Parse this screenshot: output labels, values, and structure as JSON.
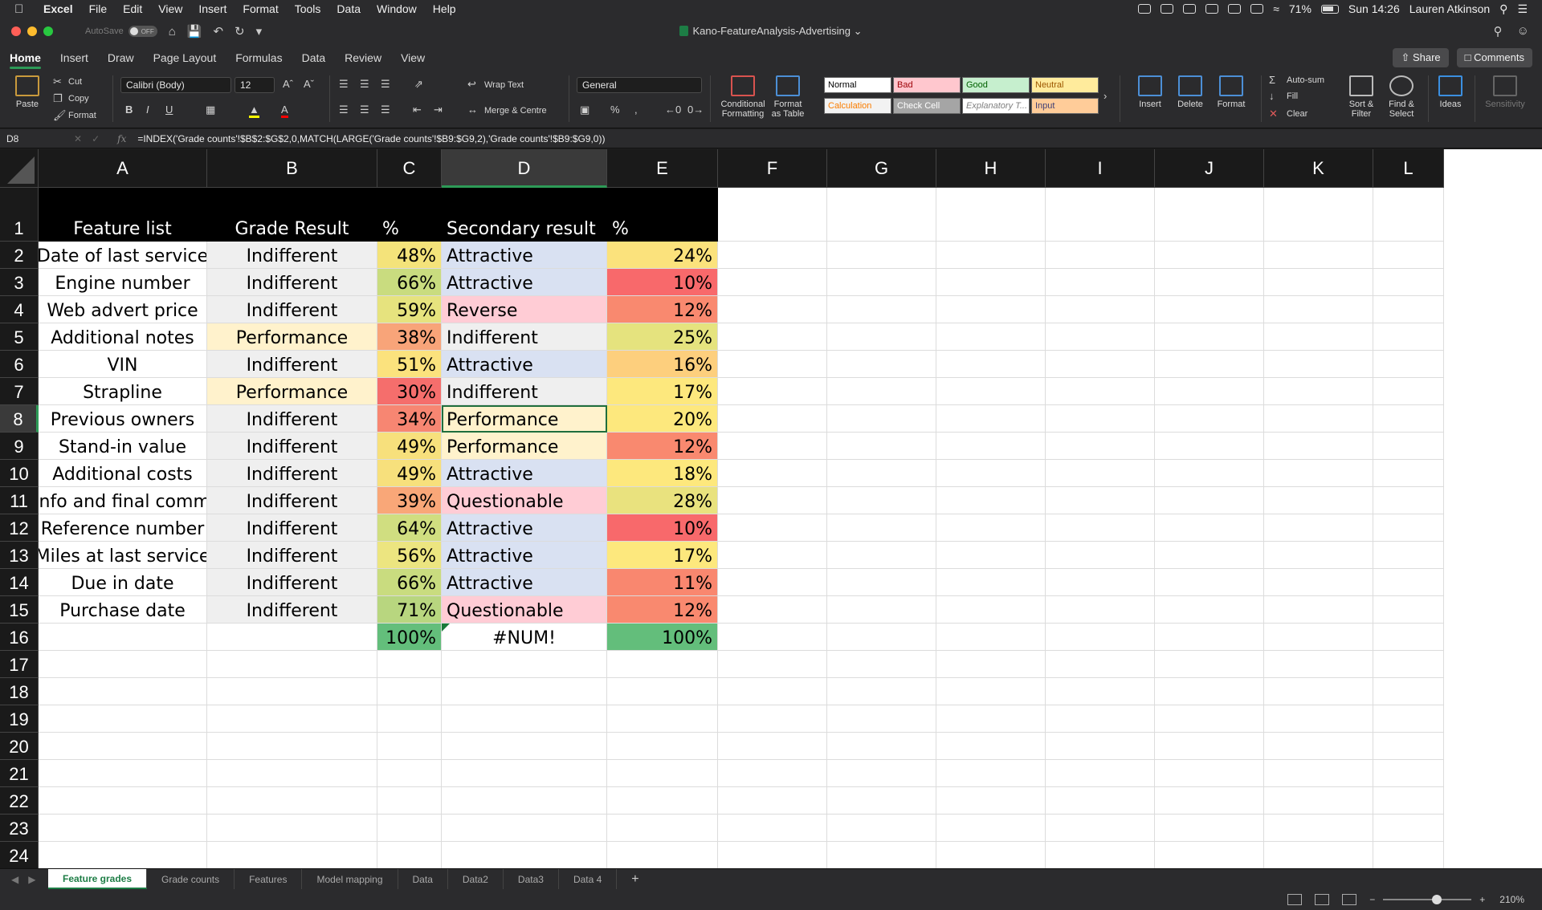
{
  "menubar": {
    "app": "Excel",
    "items": [
      "File",
      "Edit",
      "View",
      "Insert",
      "Format",
      "Tools",
      "Data",
      "Window",
      "Help"
    ],
    "battery": "71%",
    "clock": "Sun 14:26",
    "user": "Lauren Atkinson"
  },
  "titlebar": {
    "autosave_label": "AutoSave",
    "autosave_state": "OFF",
    "doc_title": "Kano-FeatureAnalysis-Advertising"
  },
  "ribbon_tabs": {
    "items": [
      "Home",
      "Insert",
      "Draw",
      "Page Layout",
      "Formulas",
      "Data",
      "Review",
      "View"
    ],
    "active": "Home",
    "share": "Share",
    "comments": "Comments"
  },
  "ribbon": {
    "paste": "Paste",
    "cut": "Cut",
    "copy": "Copy",
    "format_painter": "Format",
    "font_name": "Calibri (Body)",
    "font_size": "12",
    "wrap_text": "Wrap Text",
    "merge_centre": "Merge & Centre",
    "number_format": "General",
    "conditional_formatting": "Conditional Formatting",
    "format_as_table": "Format as Table",
    "styles": [
      {
        "name": "Normal",
        "bg": "#ffffff",
        "fg": "#000000"
      },
      {
        "name": "Bad",
        "bg": "#ffc7ce",
        "fg": "#9c0006"
      },
      {
        "name": "Good",
        "bg": "#c6efce",
        "fg": "#006100"
      },
      {
        "name": "Neutral",
        "bg": "#ffeb9c",
        "fg": "#9c5700"
      },
      {
        "name": "Calculation",
        "bg": "#f2f2f2",
        "fg": "#fa7d00"
      },
      {
        "name": "Check Cell",
        "bg": "#a5a5a5",
        "fg": "#ffffff"
      },
      {
        "name": "Explanatory T...",
        "bg": "#ffffff",
        "fg": "#7f7f7f"
      },
      {
        "name": "Input",
        "bg": "#ffcc99",
        "fg": "#3f3f76"
      }
    ],
    "insert": "Insert",
    "delete": "Delete",
    "format": "Format",
    "autosum": "Auto-sum",
    "fill": "Fill",
    "clear": "Clear",
    "sort_filter": "Sort & Filter",
    "find_select": "Find & Select",
    "ideas": "Ideas",
    "sensitivity": "Sensitivity"
  },
  "formula_bar": {
    "name_box": "D8",
    "formula": "=INDEX('Grade counts'!$B$2:$G$2,0,MATCH(LARGE('Grade counts'!$B9:$G9,2),'Grade counts'!$B9:$G9,0))"
  },
  "grid": {
    "columns": [
      "A",
      "B",
      "C",
      "D",
      "E",
      "F",
      "G",
      "H",
      "I",
      "J",
      "K",
      "L"
    ],
    "header_row": [
      "Feature list",
      "Grade Result",
      "%",
      "Secondary result",
      "%"
    ],
    "rows": [
      {
        "feature": "Date of last service",
        "grade": "Indifferent",
        "pct": "48%",
        "secondary": "Attractive",
        "pct2": "24%"
      },
      {
        "feature": "Engine number",
        "grade": "Indifferent",
        "pct": "66%",
        "secondary": "Attractive",
        "pct2": "10%"
      },
      {
        "feature": "Web advert price",
        "grade": "Indifferent",
        "pct": "59%",
        "secondary": "Reverse",
        "pct2": "12%"
      },
      {
        "feature": "Additional notes",
        "grade": "Performance",
        "pct": "38%",
        "secondary": "Indifferent",
        "pct2": "25%"
      },
      {
        "feature": "VIN",
        "grade": "Indifferent",
        "pct": "51%",
        "secondary": "Attractive",
        "pct2": "16%"
      },
      {
        "feature": "Strapline",
        "grade": "Performance",
        "pct": "30%",
        "secondary": "Indifferent",
        "pct2": "17%"
      },
      {
        "feature": "Previous owners",
        "grade": "Indifferent",
        "pct": "34%",
        "secondary": "Performance",
        "pct2": "20%"
      },
      {
        "feature": "Stand-in value",
        "grade": "Indifferent",
        "pct": "49%",
        "secondary": "Performance",
        "pct2": "12%"
      },
      {
        "feature": "Additional costs",
        "grade": "Indifferent",
        "pct": "49%",
        "secondary": "Attractive",
        "pct2": "18%"
      },
      {
        "feature": "Key info and final comments",
        "grade": "Indifferent",
        "pct": "39%",
        "secondary": "Questionable",
        "pct2": "28%"
      },
      {
        "feature": "Reference number",
        "grade": "Indifferent",
        "pct": "64%",
        "secondary": "Attractive",
        "pct2": "10%"
      },
      {
        "feature": "Miles at last service",
        "grade": "Indifferent",
        "pct": "56%",
        "secondary": "Attractive",
        "pct2": "17%"
      },
      {
        "feature": "Due in date",
        "grade": "Indifferent",
        "pct": "66%",
        "secondary": "Attractive",
        "pct2": "11%"
      },
      {
        "feature": "Purchase date",
        "grade": "Indifferent",
        "pct": "71%",
        "secondary": "Questionable",
        "pct2": "12%"
      }
    ],
    "totals": {
      "pct": "100%",
      "secondary": "#NUM!",
      "pct2": "100%"
    },
    "active_cell": "D8",
    "colors": {
      "grade": {
        "Indifferent": "#efefef",
        "Performance": "#fff2cc"
      },
      "secondary": {
        "Attractive": "#d9e1f2",
        "Reverse": "#ffccd5",
        "Indifferent": "#efefef",
        "Performance": "#fff2cc",
        "Questionable": "#ffccd5"
      },
      "pct_c": [
        "#f4e37a",
        "#c9dc7f",
        "#e6e37e",
        "#f8a479",
        "#fbe27d",
        "#f56e6c",
        "#f78672",
        "#f7e07c",
        "#f7e07c",
        "#f9a778",
        "#d0de80",
        "#ece580",
        "#c9dc7f",
        "#b8d67f"
      ],
      "pct_e": [
        "#fbe27c",
        "#f8696b",
        "#f9896f",
        "#e5e37e",
        "#fdcf7d",
        "#fde87d",
        "#fde87d",
        "#f9896f",
        "#fde87d",
        "#e9e27e",
        "#f8696b",
        "#fde87d",
        "#f9876f",
        "#f9896f"
      ],
      "total": "#63be7b"
    }
  },
  "sheets": {
    "items": [
      "Feature grades",
      "Grade counts",
      "Features",
      "Model mapping",
      "Data",
      "Data2",
      "Data3",
      "Data 4"
    ],
    "active": "Feature grades"
  },
  "status": {
    "zoom": "210%",
    "zoom_fraction": 0.55
  }
}
